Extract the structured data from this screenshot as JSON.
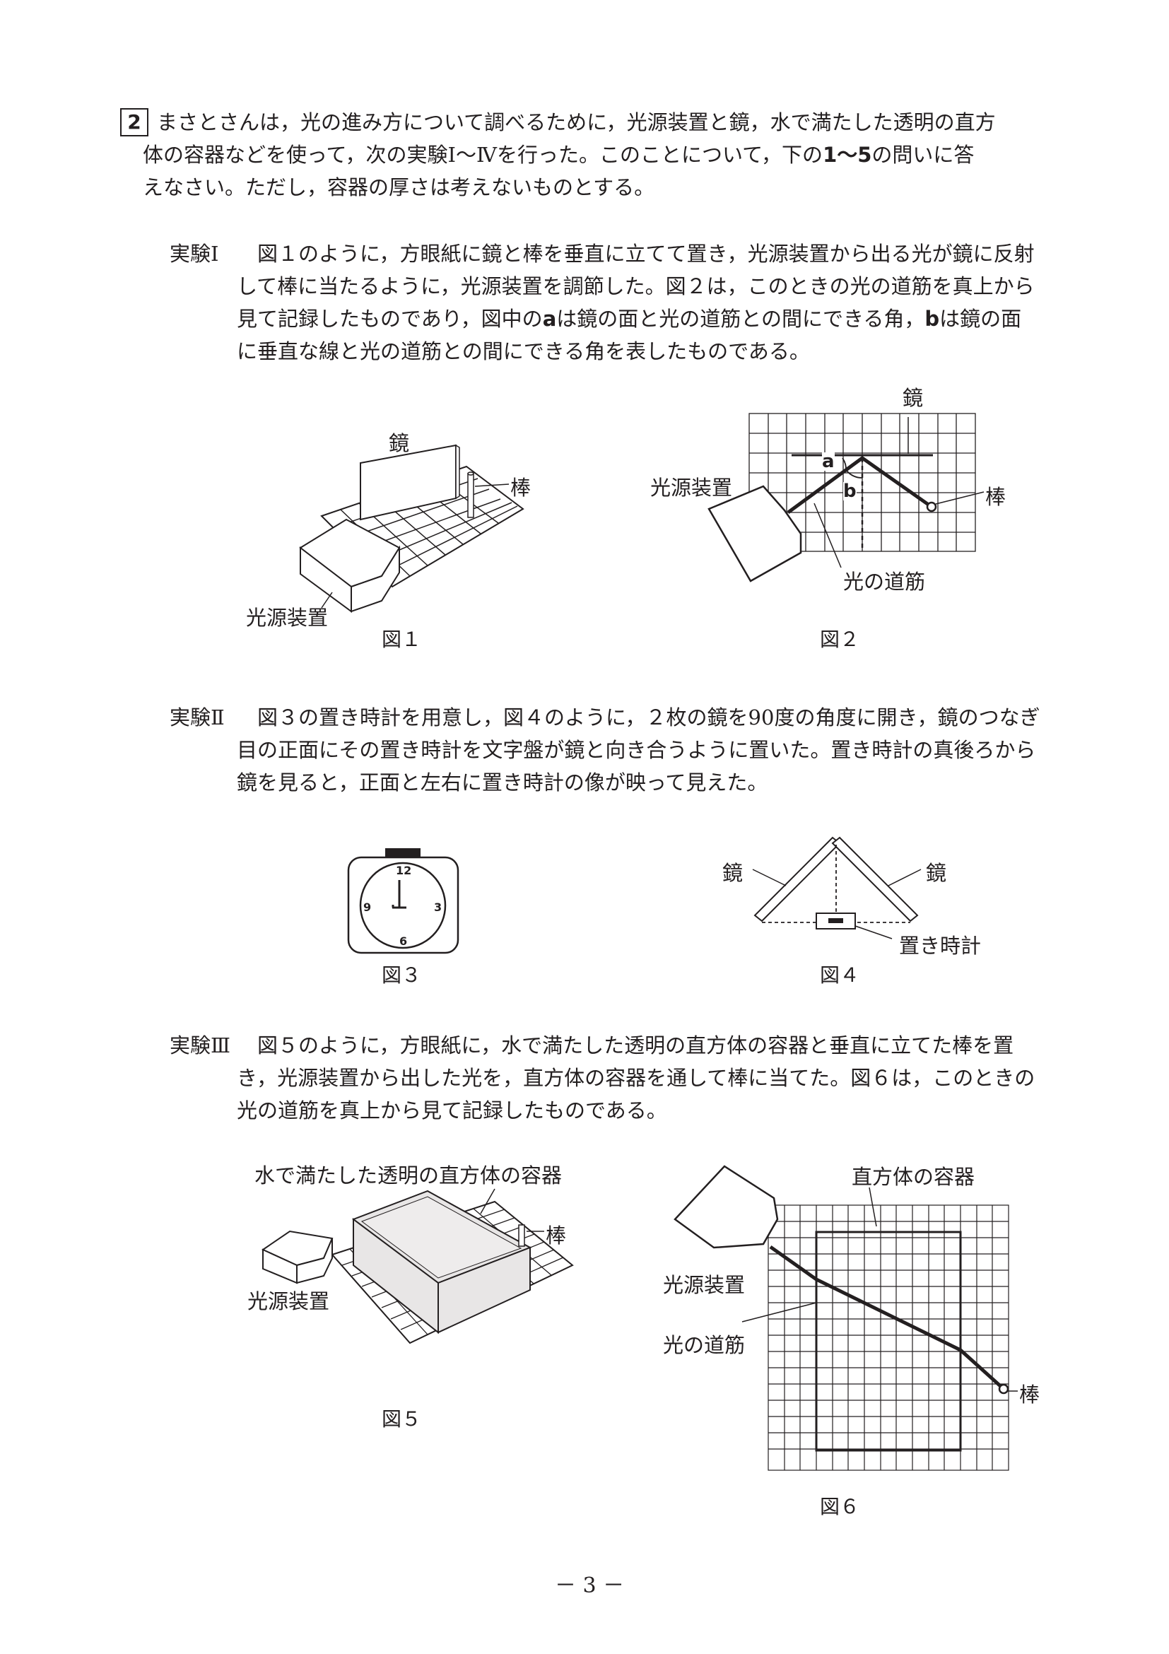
{
  "question": {
    "number": "2",
    "intro_lines": [
      "まさとさんは，光の進み方について調べるために，光源装置と鏡，水で満たした透明の直方",
      "体の容器などを使って，次の実験Ⅰ～Ⅳを行った。このことについて，下の",
      "1～5",
      "の問いに答",
      "えなさい。ただし，容器の厚さは考えないものとする。"
    ]
  },
  "exp1": {
    "head": "実験Ⅰ",
    "line1": "図１のように，方眼紙に鏡と棒を垂直に立てて置き，光源装置から出る光が鏡に反射",
    "line2": "して棒に当たるように，光源装置を調節した。図２は，このときの光の道筋を真上から",
    "line3a": "見て記録したものであり，図中の",
    "a": "a",
    "line3b": "は鏡の面と光の道筋との間にできる角，",
    "b": "b",
    "line3c": "は鏡の面",
    "line4": "に垂直な線と光の道筋との間にできる角を表したものである。"
  },
  "fig1": {
    "mirror": "鏡",
    "rod": "棒",
    "light": "光源装置",
    "caption": "図１"
  },
  "fig2": {
    "mirror": "鏡",
    "rod": "棒",
    "light": "光源装置",
    "path": "光の道筋",
    "a": "a",
    "b": "b",
    "caption": "図２"
  },
  "exp2": {
    "head": "実験Ⅱ",
    "line1": "図３の置き時計を用意し，図４のように，２枚の鏡を90度の角度に開き，鏡のつなぎ",
    "line2": "目の正面にその置き時計を文字盤が鏡と向き合うように置いた。置き時計の真後ろから",
    "line3": "鏡を見ると，正面と左右に置き時計の像が映って見えた。"
  },
  "fig3": {
    "n12": "12",
    "n3": "3",
    "n6": "6",
    "n9": "9",
    "caption": "図３"
  },
  "fig4": {
    "mirror_left": "鏡",
    "mirror_right": "鏡",
    "clock": "置き時計",
    "caption": "図４"
  },
  "exp3": {
    "head": "実験Ⅲ",
    "line1": "図５のように，方眼紙に，水で満たした透明の直方体の容器と垂直に立てた棒を置",
    "line2": "き，光源装置から出した光を，直方体の容器を通して棒に当てた。図６は，このときの",
    "line3": "光の道筋を真上から見て記録したものである。"
  },
  "fig5": {
    "container": "水で満たした透明の直方体の容器",
    "rod": "棒",
    "light": "光源装置",
    "caption": "図５"
  },
  "fig6": {
    "container": "直方体の容器",
    "light": "光源装置",
    "path": "光の道筋",
    "rod": "棒",
    "caption": "図６"
  },
  "page_number": "－ 3 －"
}
